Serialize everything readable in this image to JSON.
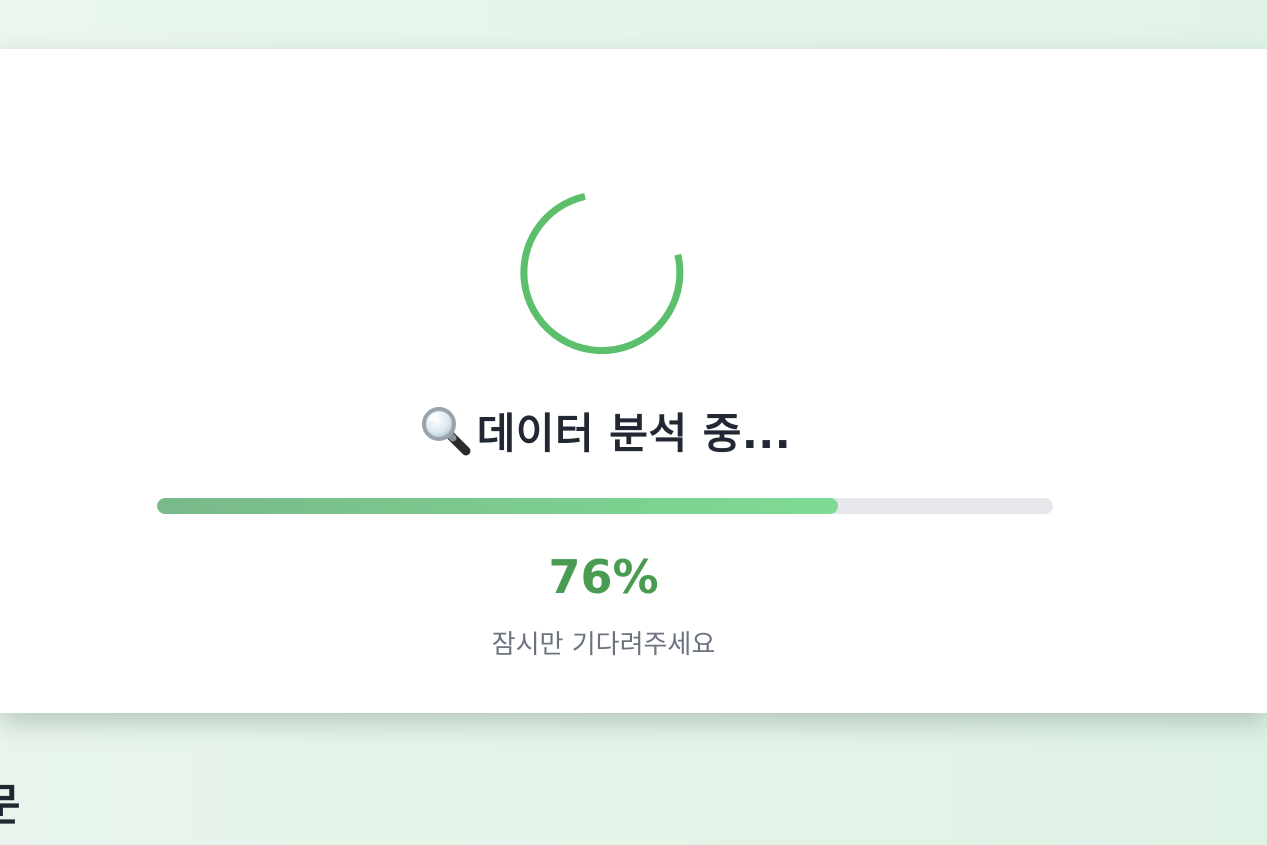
{
  "loading": {
    "title": "데이터 분석 중...",
    "icon": "magnifying-glass-icon",
    "progress_percent": 76,
    "percent_label": "76%",
    "subtext": "잠시만 기다려주세요"
  },
  "background": {
    "partial_heading": "문"
  },
  "colors": {
    "accent": "#5cbf6b",
    "percent_text": "#4a9b52",
    "progress_start": "#79b98a",
    "progress_end": "#7edb93",
    "track": "#e5e7eb",
    "title_text": "#222833",
    "subtext": "#6b7280"
  }
}
